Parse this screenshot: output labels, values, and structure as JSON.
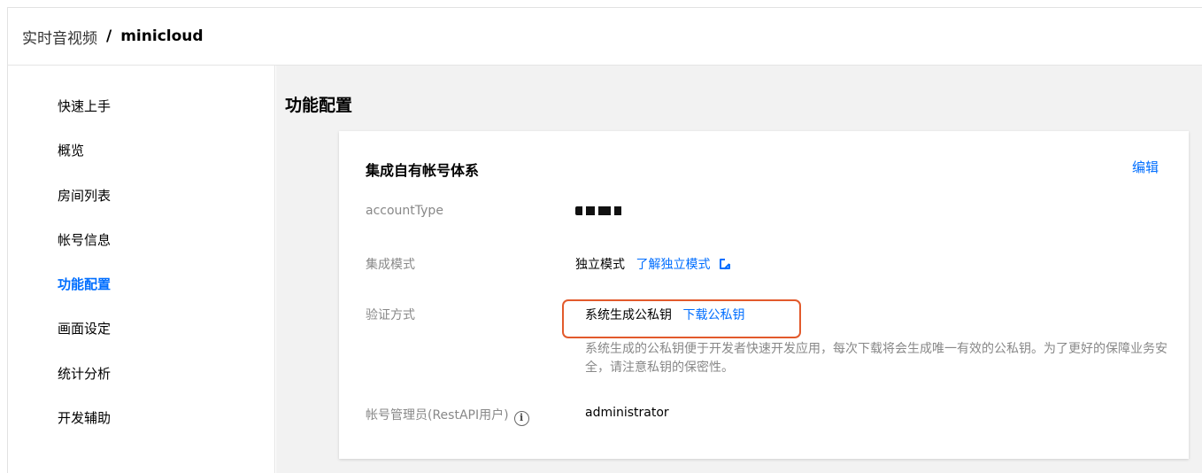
{
  "breadcrumb": {
    "root": "实时音视频",
    "separator": "/",
    "current": "minicloud"
  },
  "sidebar": {
    "items": [
      {
        "label": "快速上手",
        "active": false
      },
      {
        "label": "概览",
        "active": false
      },
      {
        "label": "房间列表",
        "active": false
      },
      {
        "label": "帐号信息",
        "active": false
      },
      {
        "label": "功能配置",
        "active": true
      },
      {
        "label": "画面设定",
        "active": false
      },
      {
        "label": "统计分析",
        "active": false
      },
      {
        "label": "开发辅助",
        "active": false
      }
    ]
  },
  "main": {
    "title": "功能配置",
    "card": {
      "title": "集成自有帐号体系",
      "edit_label": "编辑",
      "rows": {
        "account_type": {
          "label": "accountType"
        },
        "mode": {
          "label": "集成模式",
          "value": "独立模式",
          "link": "了解独立模式"
        },
        "auth": {
          "label": "验证方式",
          "value": "系统生成公私钥",
          "link": "下载公私钥",
          "description": "系统生成的公私钥便于开发者快速开发应用，每次下载将会生成唯一有效的公私钥。为了更好的保障业务安全，请注意私钥的保密性。"
        },
        "admin": {
          "label": "帐号管理员(RestAPI用户)",
          "value": "administrator"
        }
      }
    }
  },
  "colors": {
    "accent": "#006eff",
    "highlight_border": "#e25a2c",
    "muted_text": "#888888",
    "content_bg": "#f2f2f2"
  },
  "icons": [
    "external-link-icon",
    "info-icon"
  ]
}
